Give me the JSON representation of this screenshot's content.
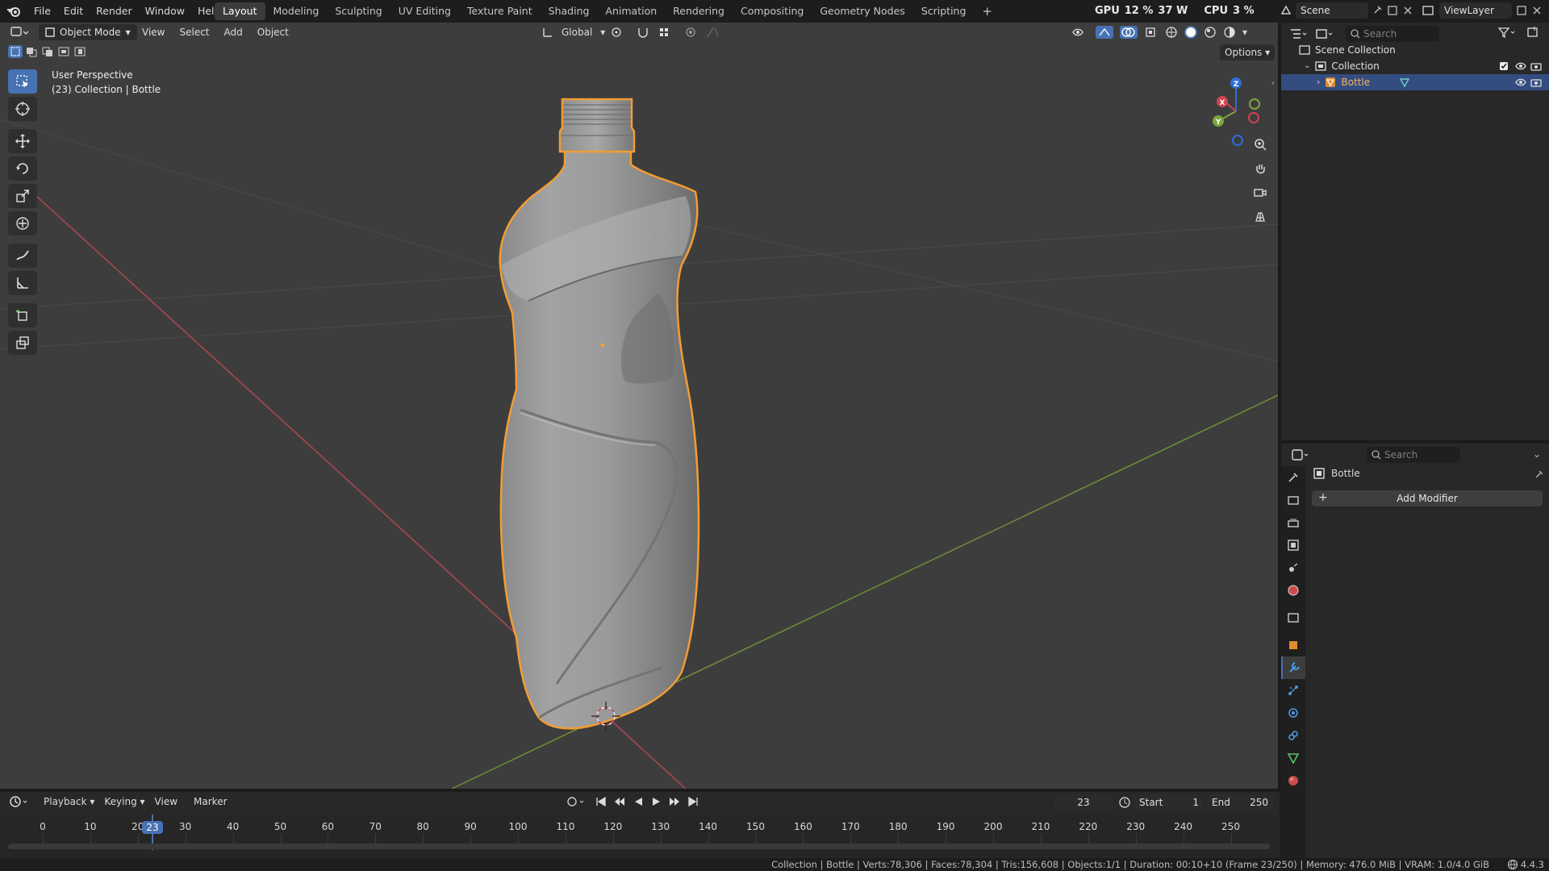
{
  "topbar": {
    "menu": [
      "File",
      "Edit",
      "Render",
      "Window",
      "Help"
    ],
    "workspaces": [
      "Layout",
      "Modeling",
      "Sculpting",
      "UV Editing",
      "Texture Paint",
      "Shading",
      "Animation",
      "Rendering",
      "Compositing",
      "Geometry Nodes",
      "Scripting"
    ],
    "active_workspace": "Layout",
    "add_workspace": "+",
    "gpu_label": "GPU",
    "gpu_value": "12 %",
    "gpu_power": "37 W",
    "cpu_label": "CPU",
    "cpu_value": "3 %",
    "scene": "Scene",
    "view_layer": "ViewLayer"
  },
  "viewport": {
    "mode": "Object Mode",
    "menu": [
      "View",
      "Select",
      "Add",
      "Object"
    ],
    "transform_orientation": "Global",
    "options": "Options",
    "info_line1": "User Perspective",
    "info_line2": "(23) Collection | Bottle",
    "gizmo_axes": {
      "x": "X",
      "y": "Y",
      "z": "Z"
    }
  },
  "outliner": {
    "search_placeholder": "Search",
    "scene_collection": "Scene Collection",
    "collection": "Collection",
    "object": "Bottle"
  },
  "properties": {
    "search_placeholder": "Search",
    "object_name": "Bottle",
    "add_modifier": "Add Modifier"
  },
  "timeline": {
    "menu": [
      "Playback",
      "Keying",
      "View",
      "Marker"
    ],
    "current_frame": "23",
    "start_label": "Start",
    "start_value": "1",
    "end_label": "End",
    "end_value": "250",
    "ticks": [
      "0",
      "10",
      "20",
      "30",
      "40",
      "50",
      "60",
      "70",
      "80",
      "90",
      "100",
      "110",
      "120",
      "130",
      "140",
      "150",
      "160",
      "170",
      "180",
      "190",
      "200",
      "210",
      "220",
      "230",
      "240",
      "250"
    ]
  },
  "statusbar": {
    "text": "Collection | Bottle | Verts:78,306 | Faces:78,304 | Tris:156,608 | Objects:1/1 | Duration: 00:10+10 (Frame 23/250) | Memory: 476.0 MiB | VRAM: 1.0/4.0 GiB",
    "version": "4.4.3"
  },
  "colors": {
    "accent": "#4772b3",
    "selection_outline": "#f39c34",
    "x_axis": "#d0444f",
    "y_axis": "#7aa63a",
    "z_axis": "#2f6ed8"
  }
}
